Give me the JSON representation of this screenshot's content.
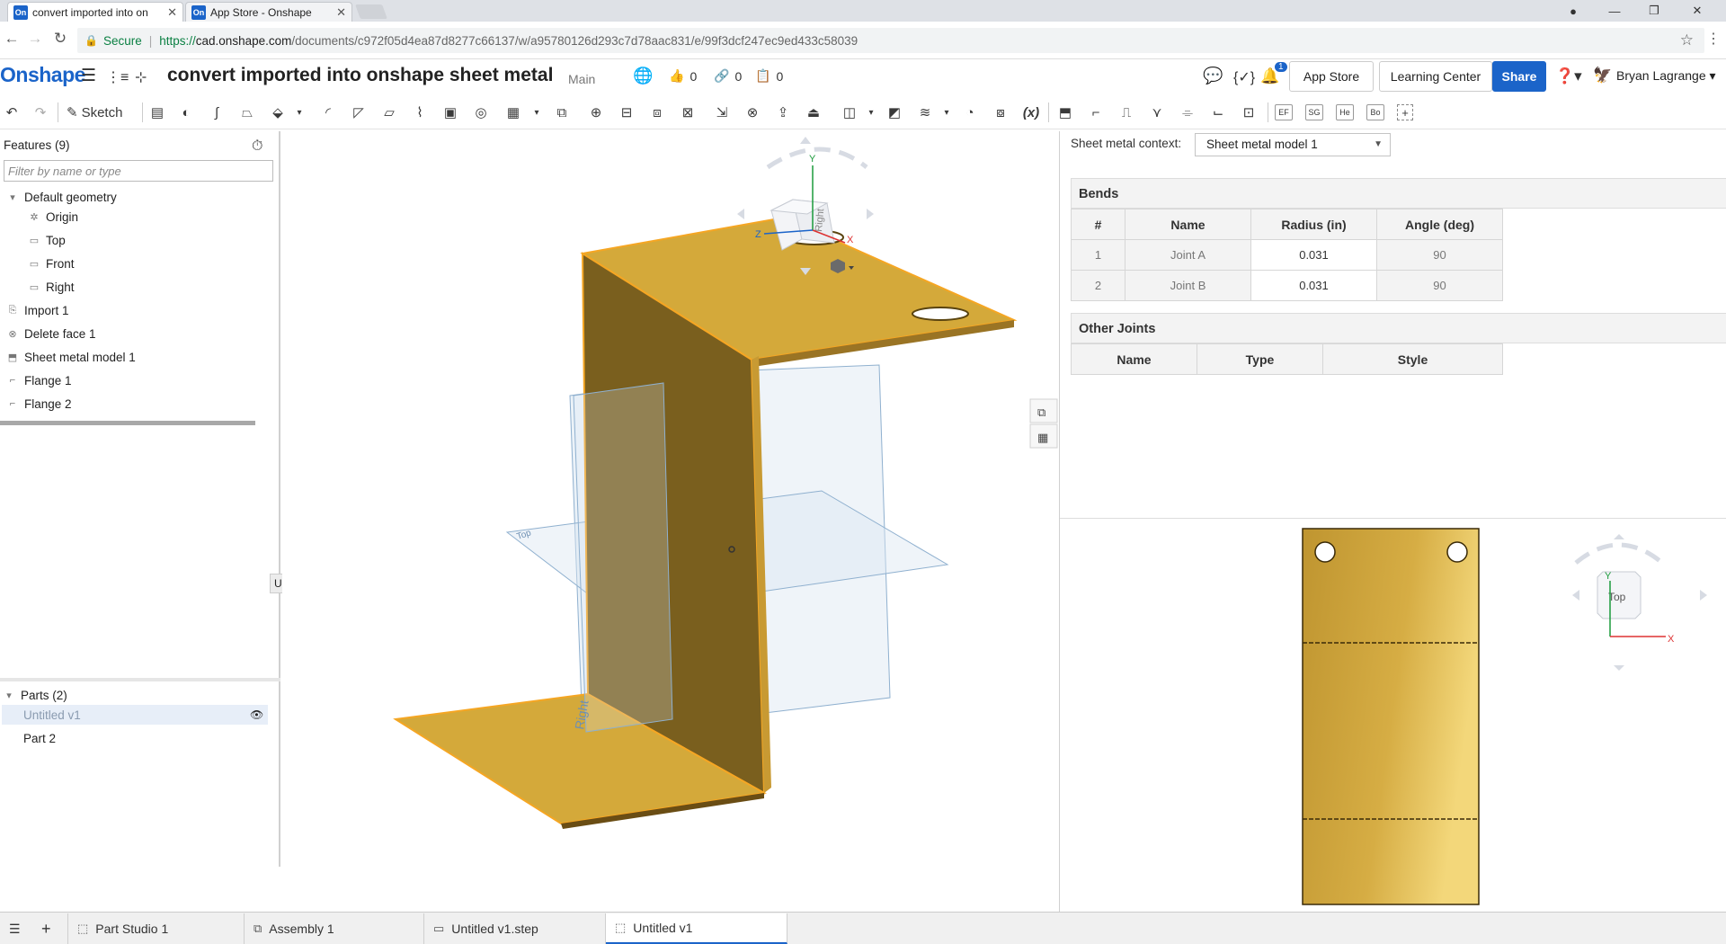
{
  "browser": {
    "tabs": [
      {
        "label": "convert imported into on",
        "favicon": "On",
        "active": true
      },
      {
        "label": "App Store - Onshape",
        "favicon": "On",
        "active": false
      }
    ],
    "secure_label": "Secure",
    "url_prefix": "https://",
    "url_host": "cad.onshape.com",
    "url_path": "/documents/c972f05d4ea87d8277c66137/w/a95780126d293c7d78aac831/e/99f3dcf247ec9ed433c58039"
  },
  "header": {
    "logo": "Onshape",
    "doc_title": "convert imported into onshape sheet metal",
    "workspace": "Main",
    "likes": "0",
    "links": "0",
    "copies": "0",
    "notifications_count": "1",
    "app_store": "App Store",
    "learning_center": "Learning Center",
    "share": "Share",
    "user": "Bryan Lagrange"
  },
  "toolbar": {
    "sketch": "Sketch",
    "text_buttons": [
      "EF",
      "SG",
      "He",
      "Bo"
    ]
  },
  "features": {
    "title": "Features (9)",
    "filter_placeholder": "Filter by name or type",
    "default_geometry": "Default geometry",
    "geometry_items": [
      "Origin",
      "Top",
      "Front",
      "Right"
    ],
    "items": [
      "Import 1",
      "Delete face 1",
      "Sheet metal model 1",
      "Flange 1",
      "Flange 2"
    ]
  },
  "parts": {
    "title": "Parts (2)",
    "items": [
      "Untitled v1",
      "Part 2"
    ],
    "tooltip": "Untitled v1"
  },
  "viewport": {
    "plane_labels": [
      "Right",
      "Top"
    ],
    "view_cube_label": "Right",
    "axis_labels": [
      "Y",
      "Z",
      "X"
    ]
  },
  "sheetmetal": {
    "context_label": "Sheet metal context:",
    "context_value": "Sheet metal model 1",
    "bends_title": "Bends",
    "bends_headers": [
      "#",
      "Name",
      "Radius (in)",
      "Angle (deg)"
    ],
    "bends_rows": [
      [
        "1",
        "Joint A",
        "0.031",
        "90"
      ],
      [
        "2",
        "Joint B",
        "0.031",
        "90"
      ]
    ],
    "joints_title": "Other Joints",
    "joints_headers": [
      "Name",
      "Type",
      "Style"
    ],
    "flat_view_cube_label": "Top",
    "flat_axis_labels": [
      "Y",
      "X"
    ]
  },
  "bottom_tabs": [
    {
      "label": "Part Studio 1",
      "icon": "part-studio-icon"
    },
    {
      "label": "Assembly 1",
      "icon": "assembly-icon"
    },
    {
      "label": "Untitled v1.step",
      "icon": "step-file-icon"
    },
    {
      "label": "Untitled v1",
      "icon": "part-studio-icon",
      "active": true
    }
  ],
  "colors": {
    "brand": "#1b64c9",
    "part_gold": "#d4a93a",
    "part_dark": "#7a5f1e",
    "selection_orange": "#f5a623"
  }
}
